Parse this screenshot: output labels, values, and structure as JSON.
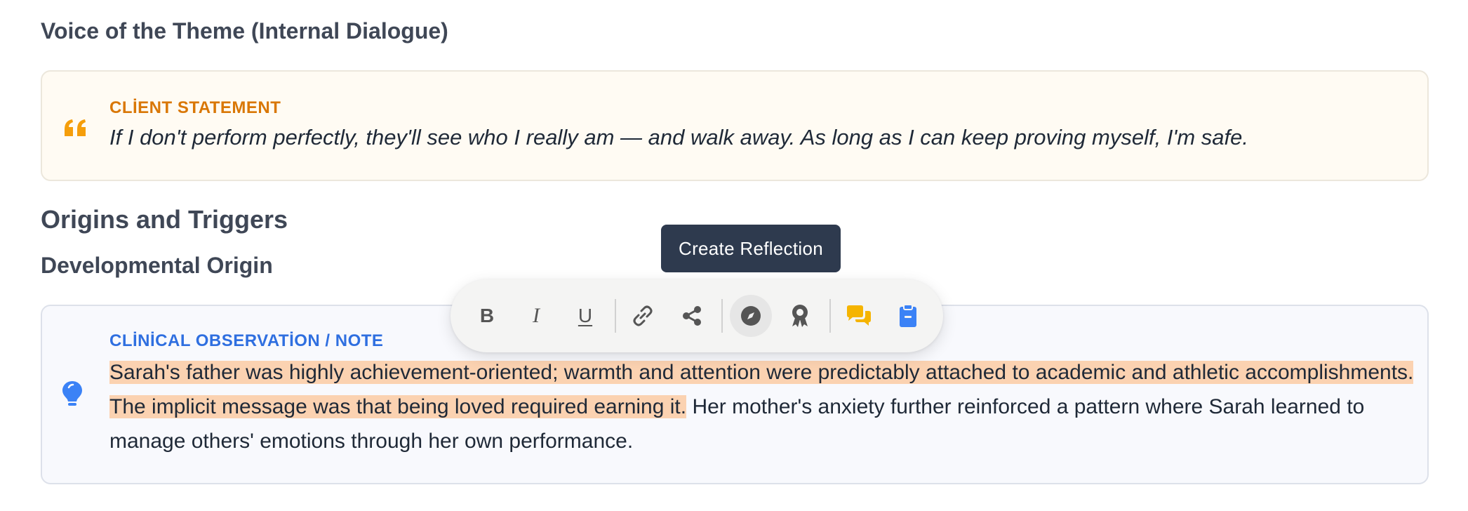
{
  "sections": {
    "voice_title": "Voice of the Theme (Internal Dialogue)",
    "origins_title": "Origins and Triggers",
    "developmental_title": "Developmental Origin"
  },
  "client_statement": {
    "label": "CLİENT STATEMENT",
    "quote": "If I don't perform perfectly, they'll see who I really am — and walk away. As long as I can keep proving myself, I'm safe.",
    "icon": "quote-icon",
    "accent": "#d97706"
  },
  "clinical_note": {
    "label": "CLİNİCAL OBSERVATİON / NOTE",
    "highlighted_text": "Sarah's father was highly achievement-oriented; warmth and attention were predictably attached to academic and athletic accomplishments. The implicit message was that being loved required earning it.",
    "remaining_text": " Her mother's anxiety further reinforced a pattern where Sarah learned to manage others' emotions through her own performance.",
    "icon": "lightbulb-icon",
    "accent": "#2f6fe0",
    "highlight_color": "#fbd2b1"
  },
  "toolbar": {
    "bold_label": "B",
    "italic_label": "I",
    "underline_label": "U",
    "tooltip": "Create Reflection",
    "buttons": [
      "bold-icon",
      "italic-icon",
      "underline-icon",
      "link-icon",
      "share-icon",
      "compass-icon",
      "award-icon",
      "comments-icon",
      "clipboard-icon"
    ],
    "comment_color": "#f5b400",
    "clipboard_color": "#3b82f6"
  }
}
